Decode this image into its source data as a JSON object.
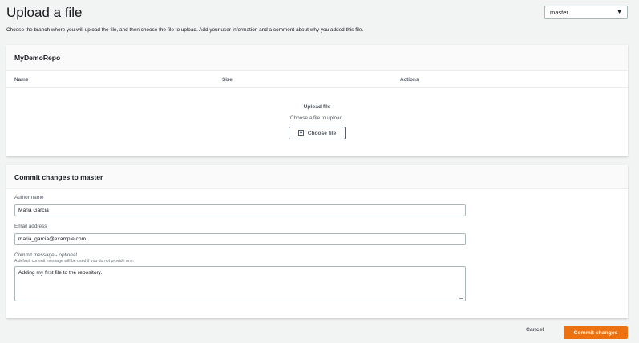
{
  "page": {
    "title": "Upload a file",
    "subtitle": "Choose the branch where you will upload the file, and then choose the file to upload. Add your user information and a comment about why you added this file."
  },
  "branch_select": {
    "value": "master"
  },
  "repo_panel": {
    "title": "MyDemoRepo",
    "columns": [
      "Name",
      "Size",
      "Actions"
    ],
    "upload_title": "Upload file",
    "upload_help": "Choose a file to upload.",
    "choose_file_label": "Choose file"
  },
  "commit_panel": {
    "title": "Commit changes to master",
    "author_label": "Author name",
    "author_value": "Maria Garcia",
    "email_label": "Email address",
    "email_value": "maria_garcia@example.com",
    "message_label": "Commit message - ",
    "message_optional": "optional",
    "message_hint": "A default commit message will be used if you do not provide one.",
    "message_value": "Adding my first file to the repository."
  },
  "actions": {
    "cancel_label": "Cancel",
    "commit_label": "Commit changes"
  },
  "colors": {
    "primary": "#ec7211",
    "background": "#f2f3f3",
    "text_secondary": "#545b64"
  },
  "icons": {
    "choose_file": "file-upload-icon",
    "branch_caret": "caret-down-icon"
  }
}
